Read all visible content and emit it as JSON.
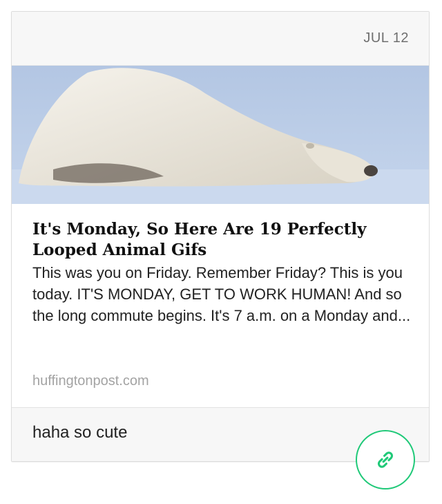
{
  "post": {
    "date": "JUL 12",
    "image": {
      "subject": "polar bear lying on snow",
      "colors": {
        "sky": "#b8c9e2",
        "snow": "#cfdcef",
        "fur": "#efebe2"
      }
    },
    "headline": "It's Monday, So Here Are 19 Perfectly Looped Animal Gifs",
    "summary": "This was you on Friday. Remember Friday? This is you today. IT'S MONDAY, GET TO WORK HUMAN! And so the long commute begins. It's 7 a.m. on a Monday and...",
    "source": "huffingtonpost.com",
    "comment": "haha so cute"
  },
  "actions": {
    "link_icon": "link-icon",
    "accent_color": "#1fc978"
  }
}
